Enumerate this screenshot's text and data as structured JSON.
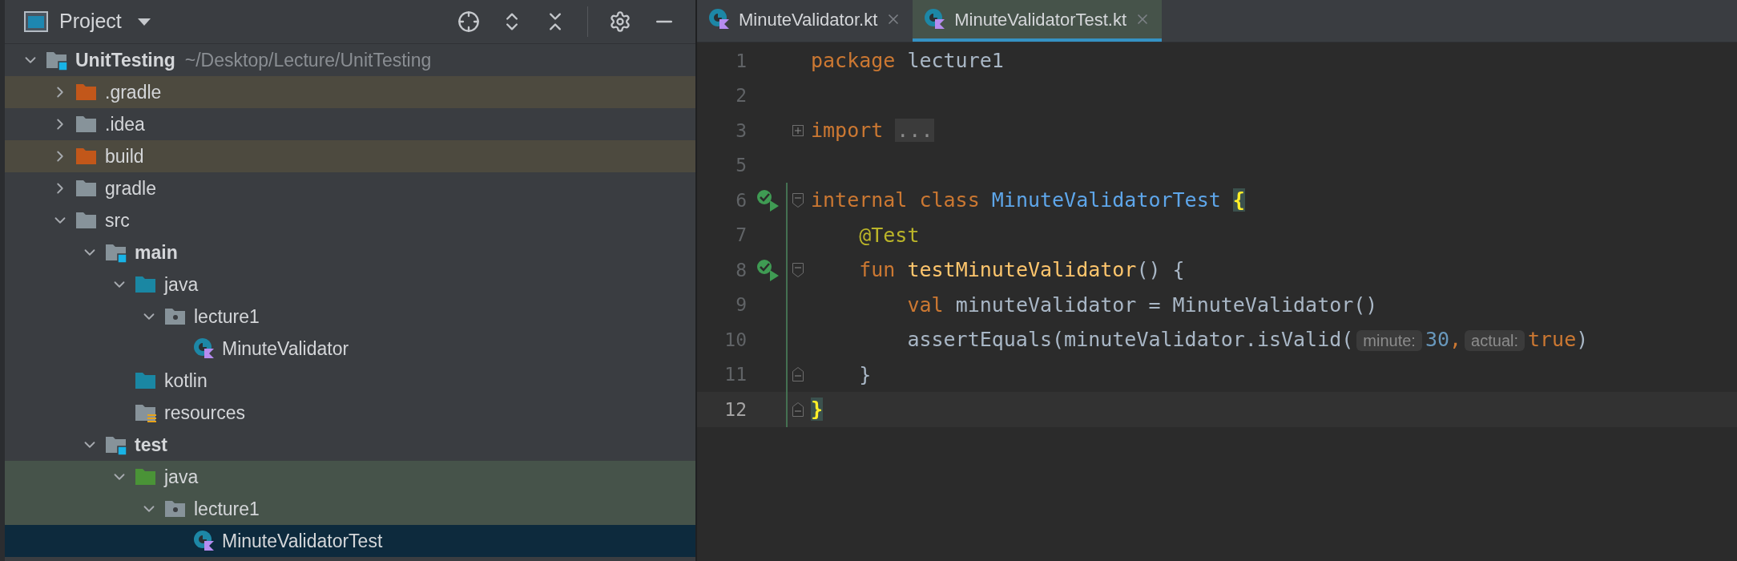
{
  "project_panel": {
    "title": "Project",
    "tree": [
      {
        "label": "UnitTesting",
        "path": "~/Desktop/Lecture/UnitTesting",
        "kind": "module",
        "bold": true,
        "expanded": true,
        "excluded": false,
        "test_scope": false,
        "selected": false,
        "children": [
          {
            "label": ".gradle",
            "kind": "excluded",
            "bold": false,
            "expanded": false,
            "excluded": true,
            "test_scope": false,
            "selected": false
          },
          {
            "label": ".idea",
            "kind": "folder",
            "bold": false,
            "expanded": false,
            "excluded": false,
            "test_scope": false,
            "selected": false
          },
          {
            "label": "build",
            "kind": "excluded",
            "bold": false,
            "expanded": false,
            "excluded": true,
            "test_scope": false,
            "selected": false
          },
          {
            "label": "gradle",
            "kind": "folder",
            "bold": false,
            "expanded": false,
            "excluded": false,
            "test_scope": false,
            "selected": false
          },
          {
            "label": "src",
            "kind": "folder",
            "bold": false,
            "expanded": true,
            "excluded": false,
            "test_scope": false,
            "selected": false,
            "children": [
              {
                "label": "main",
                "kind": "module",
                "bold": true,
                "expanded": true,
                "excluded": false,
                "test_scope": false,
                "selected": false,
                "children": [
                  {
                    "label": "java",
                    "kind": "source",
                    "bold": false,
                    "expanded": true,
                    "excluded": false,
                    "test_scope": false,
                    "selected": false,
                    "children": [
                      {
                        "label": "lecture1",
                        "kind": "package",
                        "bold": false,
                        "expanded": true,
                        "excluded": false,
                        "test_scope": false,
                        "selected": false,
                        "children": [
                          {
                            "label": "MinuteValidator",
                            "kind": "kotlin-class",
                            "bold": false,
                            "excluded": false,
                            "test_scope": false,
                            "selected": false
                          }
                        ]
                      }
                    ]
                  },
                  {
                    "label": "kotlin",
                    "kind": "source",
                    "bold": false,
                    "excluded": false,
                    "test_scope": false,
                    "selected": false
                  },
                  {
                    "label": "resources",
                    "kind": "resources",
                    "bold": false,
                    "excluded": false,
                    "test_scope": false,
                    "selected": false
                  }
                ]
              },
              {
                "label": "test",
                "kind": "module",
                "bold": true,
                "expanded": true,
                "excluded": false,
                "test_scope": false,
                "selected": false,
                "children": [
                  {
                    "label": "java",
                    "kind": "test-source",
                    "bold": false,
                    "expanded": true,
                    "excluded": false,
                    "test_scope": true,
                    "selected": false,
                    "children": [
                      {
                        "label": "lecture1",
                        "kind": "package",
                        "bold": false,
                        "expanded": true,
                        "excluded": false,
                        "test_scope": true,
                        "selected": false,
                        "children": [
                          {
                            "label": "MinuteValidatorTest",
                            "kind": "kotlin-class",
                            "bold": false,
                            "selected": true
                          }
                        ]
                      }
                    ]
                  }
                ]
              }
            ]
          }
        ]
      }
    ]
  },
  "editor": {
    "tabs": [
      {
        "label": "MinuteValidator.kt",
        "selected": false
      },
      {
        "label": "MinuteValidatorTest.kt",
        "selected": true
      }
    ],
    "lines": [
      {
        "number": "1",
        "run": false,
        "changed": false,
        "current": false,
        "tokens": [
          {
            "kind": "keyword",
            "text": "package"
          },
          {
            "kind": "plain",
            "text": " lecture1"
          }
        ]
      },
      {
        "number": "2",
        "run": false,
        "changed": false,
        "current": false
      },
      {
        "number": "3",
        "run": false,
        "fold": {
          "kind": "expand"
        },
        "changed": false,
        "current": false,
        "tokens": [
          {
            "kind": "keyword",
            "text": "import"
          },
          {
            "kind": "folded",
            "text": "..."
          }
        ]
      },
      {
        "number": "5",
        "run": false,
        "changed": false,
        "current": false
      },
      {
        "number": "6",
        "run": true,
        "fold": {
          "kind": "start"
        },
        "changed": true,
        "current": false,
        "tokens": [
          {
            "kind": "keyword",
            "text": "internal class "
          },
          {
            "kind": "class",
            "text": "MinuteValidatorTest "
          },
          {
            "kind": "brace",
            "text": "{"
          }
        ]
      },
      {
        "number": "7",
        "run": false,
        "changed": true,
        "current": false,
        "tokens": [
          {
            "kind": "annotation",
            "text": "    @Test"
          }
        ]
      },
      {
        "number": "8",
        "run": true,
        "fold": {
          "kind": "start"
        },
        "changed": true,
        "current": false,
        "tokens": [
          {
            "kind": "keyword",
            "text": "    fun "
          },
          {
            "kind": "function",
            "text": "testMinuteValidator"
          },
          {
            "kind": "plain",
            "text": "() {"
          }
        ]
      },
      {
        "number": "9",
        "run": false,
        "changed": true,
        "current": false,
        "tokens": [
          {
            "kind": "keyword",
            "text": "        val"
          },
          {
            "kind": "plain",
            "text": " minuteValidator = MinuteValidator()"
          }
        ]
      },
      {
        "number": "10",
        "run": false,
        "changed": true,
        "current": false,
        "tokens": [
          {
            "kind": "plain",
            "text": "        assertEquals(minuteValidator.isValid("
          },
          {
            "kind": "hint",
            "text": "minute:"
          },
          {
            "kind": "number",
            "text": "30"
          },
          {
            "kind": "keyword",
            "text": ","
          },
          {
            "kind": "hint",
            "text": "actual:"
          },
          {
            "kind": "keyword",
            "text": "true"
          },
          {
            "kind": "plain",
            "text": ")"
          }
        ]
      },
      {
        "number": "11",
        "run": false,
        "fold": {
          "kind": "end"
        },
        "changed": true,
        "current": false,
        "tokens": [
          {
            "kind": "plain",
            "text": "    }"
          }
        ]
      },
      {
        "number": "12",
        "run": false,
        "fold": {
          "kind": "end"
        },
        "changed": true,
        "current": true,
        "tokens": [
          {
            "kind": "brace",
            "text": "}"
          }
        ]
      }
    ]
  }
}
